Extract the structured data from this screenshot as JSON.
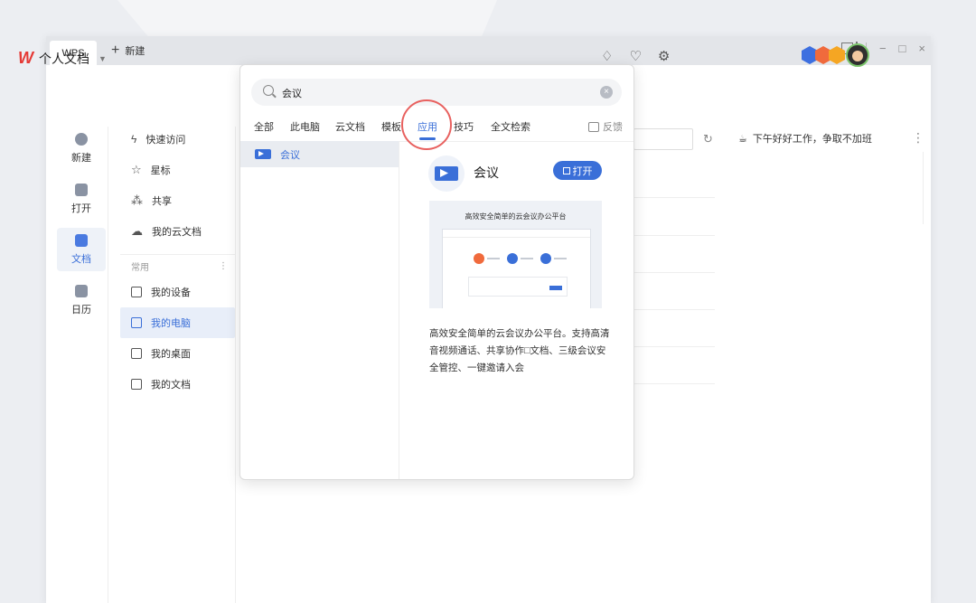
{
  "tabs": {
    "wps": "WPS",
    "new": "新建"
  },
  "header": {
    "title": "个人文档"
  },
  "leftnav": [
    {
      "label": "新建",
      "icon": "plus-circle-icon"
    },
    {
      "label": "打开",
      "icon": "folder-icon"
    },
    {
      "label": "文档",
      "icon": "document-icon",
      "active": true
    },
    {
      "label": "日历",
      "icon": "calendar-icon"
    }
  ],
  "subnav": {
    "top": [
      {
        "label": "快速访问",
        "icon": "bolt-icon"
      },
      {
        "label": "星标",
        "icon": "star-icon"
      },
      {
        "label": "共享",
        "icon": "share-icon"
      },
      {
        "label": "我的云文档",
        "icon": "cloud-icon"
      }
    ],
    "section_label": "常用",
    "common": [
      {
        "label": "我的设备",
        "icon": "device-icon"
      },
      {
        "label": "我的电脑",
        "icon": "computer-icon",
        "active": true
      },
      {
        "label": "我的桌面",
        "icon": "desktop-icon"
      },
      {
        "label": "我的文档",
        "icon": "folder-doc-icon"
      }
    ]
  },
  "greeting": "下午好好工作，争取不加班",
  "popup": {
    "search_value": "会议",
    "tabs": [
      "全部",
      "此电脑",
      "云文档",
      "模板",
      "应用",
      "技巧",
      "全文检索"
    ],
    "active_tab": "应用",
    "feedback": "反馈",
    "result": {
      "label": "会议"
    },
    "detail": {
      "name": "会议",
      "open_label": "打开",
      "preview_title": "高效安全简单的云会议办公平台",
      "description": "高效安全简单的云会议办公平台。支持高清音视频通话、共享协作□文档、三级会议安全管控、一键邀请入会"
    }
  },
  "colors": {
    "accent": "#3a6fd8",
    "highlight_ring": "#e8615f",
    "logo_red": "#e53935"
  }
}
